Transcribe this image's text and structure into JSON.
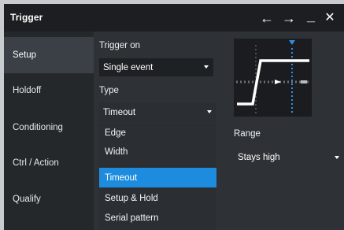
{
  "window": {
    "title": "Trigger",
    "controls": {
      "back": "←",
      "forward": "→",
      "minimize": "_",
      "close": "✕"
    }
  },
  "sidebar": {
    "items": [
      {
        "label": "Setup",
        "active": true
      },
      {
        "label": "Holdoff",
        "active": false
      },
      {
        "label": "Conditioning",
        "active": false
      },
      {
        "label": "Ctrl / Action",
        "active": false
      },
      {
        "label": "Qualify",
        "active": false
      }
    ]
  },
  "setup": {
    "trigger_on_label": "Trigger on",
    "trigger_on_value": "Single event",
    "type_label": "Type",
    "type_value": "Timeout",
    "type_options": [
      "Edge",
      "Width",
      "Timeout",
      "Setup & Hold",
      "Serial pattern"
    ],
    "type_selected": "Timeout",
    "range_label": "Range",
    "range_value": "Stays high"
  },
  "colors": {
    "accent": "#1e8cde",
    "panel": "#2e3236",
    "sidebar": "#25282b",
    "titlebar": "#1c1e21",
    "field": "#1e2124"
  },
  "icons": {
    "back": "arrow-left-icon",
    "forward": "arrow-right-icon",
    "minimize": "minimize-icon",
    "close": "close-icon",
    "dropdown": "chevron-down-icon",
    "preview": "timeout-signal-icon"
  }
}
